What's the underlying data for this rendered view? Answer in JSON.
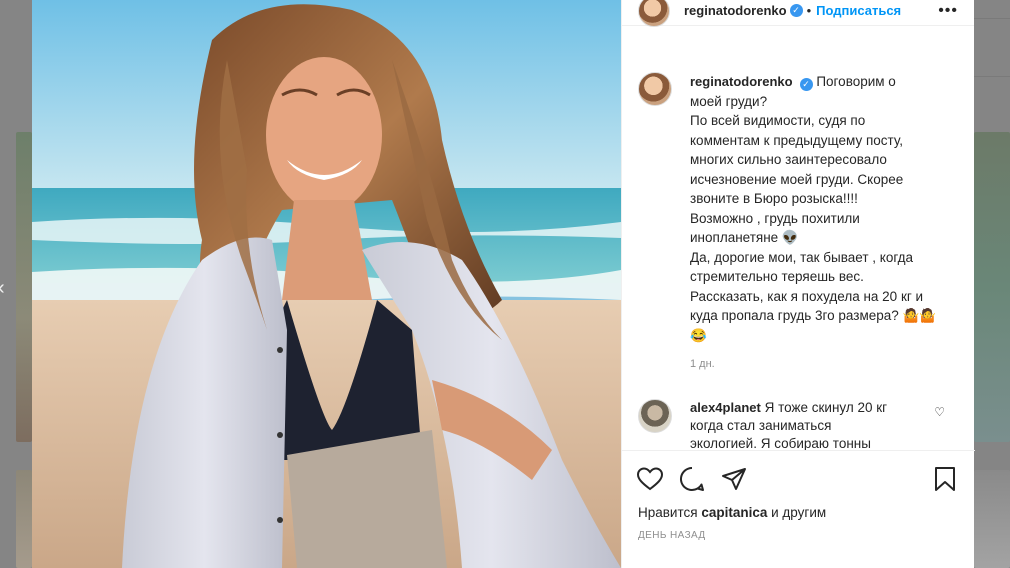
{
  "post": {
    "username": "reginatodorenko",
    "follow_label": "Подписаться",
    "separator": "•",
    "more": "•••",
    "caption_lines": [
      "Поговорим о",
      "моей груди?",
      "По всей видимости, судя по",
      "комментам к предыдущему посту,",
      "многих сильно заинтересовало",
      "исчезновение моей груди. Скорее",
      "звоните в Бюро розыска!!!!",
      "Возможно , грудь похитили",
      "инопланетяне 👽",
      "Да, дорогие мои, так бывает , когда",
      "стремительно теряешь вес.",
      "Рассказать, как я похудела на 20 кг и",
      "куда пропала грудь 3го размера? 🤷🤷",
      "😂"
    ],
    "time_ago": "1 дн."
  },
  "comment": {
    "username": "alex4planet",
    "text_lines": [
      "Я тоже скинул 20 кг",
      "когда стал заниматься",
      "экологией. Я собираю тонны"
    ]
  },
  "footer": {
    "likes_prefix": "Нравится",
    "likes_user": "capitanica",
    "likes_suffix": "и другим",
    "date": "ДЕНЬ НАЗАД"
  },
  "icons": {
    "verified": "✓",
    "left_nav": "‹",
    "heart_small": "♡"
  }
}
